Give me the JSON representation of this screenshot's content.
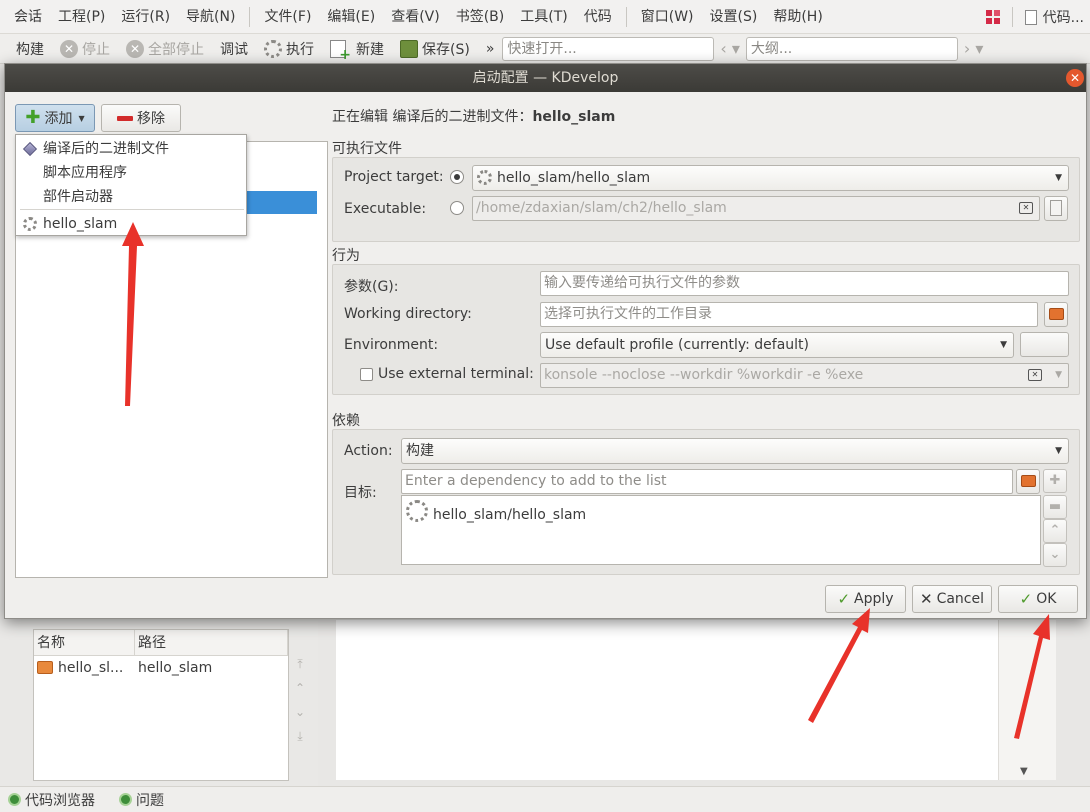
{
  "menubar": {
    "items": [
      "会话",
      "工程(P)",
      "运行(R)",
      "导航(N)",
      "文件(F)",
      "编辑(E)",
      "查看(V)",
      "书签(B)",
      "工具(T)",
      "代码",
      "窗口(W)",
      "设置(S)",
      "帮助(H)"
    ],
    "right_label": "代码..."
  },
  "toolbar": {
    "build": "构建",
    "stop": "停止",
    "stop_all": "全部停止",
    "debug": "调试",
    "execute": "执行",
    "new": "新建",
    "save": "保存(S)",
    "more": "»",
    "quick_open_placeholder": "快速打开...",
    "outline_placeholder": "大纲..."
  },
  "background": {
    "table_headers": [
      "名称",
      "路径"
    ],
    "table_row": {
      "name": "hello_sl...",
      "path": "hello_slam"
    },
    "status_items": [
      "代码浏览器",
      "问题"
    ]
  },
  "dialog": {
    "title": "启动配置 — KDevelop",
    "add_label": "添加",
    "remove_label": "移除",
    "add_menu": {
      "items": [
        "编译后的二进制文件",
        "脚本应用程序",
        "部件启动器"
      ],
      "project_item": "hello_slam"
    },
    "editing_prefix": "正在编辑 编译后的二进制文件：",
    "editing_name": "hello_slam",
    "executable_group": {
      "title": "可执行文件",
      "project_target_label": "Project target:",
      "project_target_value": "hello_slam/hello_slam",
      "executable_label": "Executable:",
      "executable_value": "/home/zdaxian/slam/ch2/hello_slam"
    },
    "behavior_group": {
      "title": "行为",
      "args_label": "参数(G):",
      "args_placeholder": "输入要传递给可执行文件的参数",
      "workdir_label": "Working directory:",
      "workdir_placeholder": "选择可执行文件的工作目录",
      "env_label": "Environment:",
      "env_value": "Use default profile (currently: default)",
      "terminal_label": "Use external terminal:",
      "terminal_value": "konsole --noclose --workdir %workdir -e %exe"
    },
    "deps_group": {
      "title": "依赖",
      "action_label": "Action:",
      "action_value": "构建",
      "targets_label": "目标:",
      "targets_placeholder": "Enter a dependency to add to the list",
      "targets_items": [
        "hello_slam/hello_slam"
      ]
    },
    "buttons": {
      "apply": "Apply",
      "cancel": "Cancel",
      "ok": "OK"
    }
  },
  "colors": {
    "selection": "#3a8fd8",
    "annotation_arrow": "#e8322a",
    "close_button": "#e4582e"
  }
}
